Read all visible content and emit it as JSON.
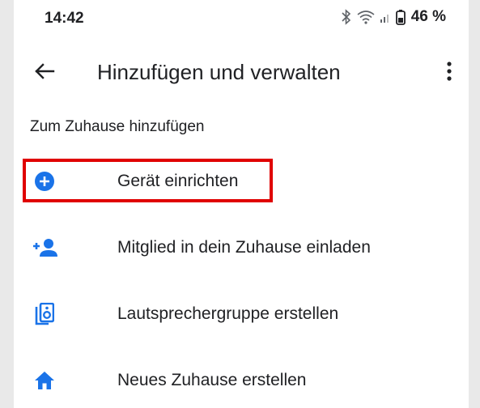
{
  "status_bar": {
    "time": "14:42",
    "battery": "46 %",
    "icons": [
      "bluetooth-icon",
      "wifi-icon",
      "signal-icon",
      "battery-icon"
    ]
  },
  "app_bar": {
    "title": "Hinzufügen und verwalten",
    "back_icon": "arrow-back-icon",
    "more_icon": "more-vert-icon"
  },
  "section": {
    "title": "Zum Zuhause hinzufügen"
  },
  "items": [
    {
      "label": "Gerät einrichten",
      "icon": "add-circle-icon"
    },
    {
      "label": "Mitglied in dein Zuhause einladen",
      "icon": "person-add-icon"
    },
    {
      "label": "Lautsprechergruppe erstellen",
      "icon": "speaker-group-icon"
    },
    {
      "label": "Neues Zuhause erstellen",
      "icon": "home-icon"
    }
  ],
  "colors": {
    "accent": "#1a73e8",
    "highlight": "#e00000",
    "text": "#202124"
  }
}
